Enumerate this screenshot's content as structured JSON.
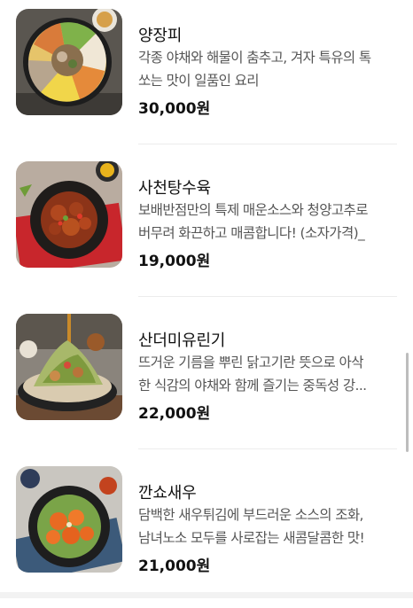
{
  "menu": {
    "items": [
      {
        "title": "양장피",
        "desc_line1": "각종 야채와 해물이 춤추고, 겨자 특유의 톡",
        "desc_line2": "쏘는 맛이 일품인 요리",
        "price": "30,000원"
      },
      {
        "title": "사천탕수육",
        "desc_line1": "보배반점만의 특제 매운소스와 청양고추로",
        "desc_line2": "버무려 화끈하고 매콤합니다! (소자가격)_",
        "price": "19,000원"
      },
      {
        "title": "산더미유린기",
        "desc_line1": "뜨거운 기름을 뿌린 닭고기란 뜻으로 아삭",
        "desc_line2": "한 식감의 야채와 함께 즐기는 중독성 강...",
        "price": "22,000원"
      },
      {
        "title": "깐쇼새우",
        "desc_line1": "담백한 새우튀김에 부드러운 소스의 조화,",
        "desc_line2": "남녀노소 모두를 사로잡는 새콤달콤한 맛!",
        "price": "21,000원"
      }
    ]
  },
  "colors": {
    "title": "#111111",
    "description": "#555555",
    "divider": "#ececec",
    "scrollbar": "#bdbdbd"
  }
}
